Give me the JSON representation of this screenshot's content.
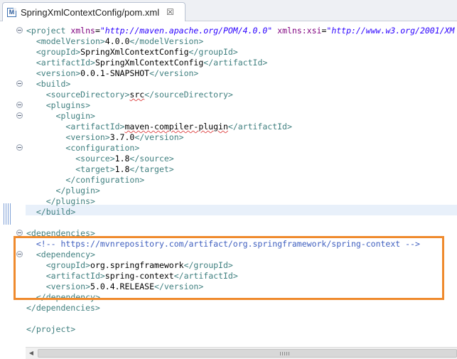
{
  "tab": {
    "icon": "M",
    "title": "SpringXmlContextConfig/pom.xml",
    "close_symbol": "☒"
  },
  "colors": {
    "tag": "#3f7f7f",
    "attribute": "#7f007f",
    "string": "#2a00ff",
    "comment": "#3f5fbf",
    "highlight_box": "#ef8a2d"
  },
  "code": {
    "lines": [
      {
        "indent": "",
        "parts": [
          {
            "k": "t",
            "v": "<project "
          },
          {
            "k": "a",
            "v": "xmlns"
          },
          {
            "k": "x",
            "v": "="
          },
          {
            "k": "s",
            "v": "\"http://maven.apache.org/POM/4.0.0\""
          },
          {
            "k": "x",
            "v": " "
          },
          {
            "k": "a",
            "v": "xmlns:xsi"
          },
          {
            "k": "x",
            "v": "="
          },
          {
            "k": "s",
            "v": "\"http://www.w3.org/2001/XM"
          }
        ]
      },
      {
        "indent": "  ",
        "parts": [
          {
            "k": "t",
            "v": "<modelVersion>"
          },
          {
            "k": "x",
            "v": "4.0.0"
          },
          {
            "k": "t",
            "v": "</modelVersion>"
          }
        ]
      },
      {
        "indent": "  ",
        "parts": [
          {
            "k": "t",
            "v": "<groupId>"
          },
          {
            "k": "x",
            "v": "SpringXmlContextConfig"
          },
          {
            "k": "t",
            "v": "</groupId>"
          }
        ]
      },
      {
        "indent": "  ",
        "parts": [
          {
            "k": "t",
            "v": "<artifactId>"
          },
          {
            "k": "x",
            "v": "SpringXmlContextConfig"
          },
          {
            "k": "t",
            "v": "</artifactId>"
          }
        ]
      },
      {
        "indent": "  ",
        "parts": [
          {
            "k": "t",
            "v": "<version>"
          },
          {
            "k": "x",
            "v": "0.0.1-SNAPSHOT"
          },
          {
            "k": "t",
            "v": "</version>"
          }
        ]
      },
      {
        "indent": "  ",
        "parts": [
          {
            "k": "t",
            "v": "<build>"
          }
        ]
      },
      {
        "indent": "    ",
        "parts": [
          {
            "k": "t",
            "v": "<sourceDirectory>"
          },
          {
            "k": "q",
            "v": "src"
          },
          {
            "k": "t",
            "v": "</sourceDirectory>"
          }
        ]
      },
      {
        "indent": "    ",
        "parts": [
          {
            "k": "t",
            "v": "<plugins>"
          }
        ]
      },
      {
        "indent": "      ",
        "parts": [
          {
            "k": "t",
            "v": "<plugin>"
          }
        ]
      },
      {
        "indent": "        ",
        "parts": [
          {
            "k": "t",
            "v": "<artifactId>"
          },
          {
            "k": "q",
            "v": "maven-compiler-plugin"
          },
          {
            "k": "t",
            "v": "</artifactId>"
          }
        ]
      },
      {
        "indent": "        ",
        "parts": [
          {
            "k": "t",
            "v": "<version>"
          },
          {
            "k": "x",
            "v": "3.7.0"
          },
          {
            "k": "t",
            "v": "</version>"
          }
        ]
      },
      {
        "indent": "        ",
        "parts": [
          {
            "k": "t",
            "v": "<configuration>"
          }
        ]
      },
      {
        "indent": "          ",
        "parts": [
          {
            "k": "t",
            "v": "<source>"
          },
          {
            "k": "x",
            "v": "1.8"
          },
          {
            "k": "t",
            "v": "</source>"
          }
        ]
      },
      {
        "indent": "          ",
        "parts": [
          {
            "k": "t",
            "v": "<target>"
          },
          {
            "k": "x",
            "v": "1.8"
          },
          {
            "k": "t",
            "v": "</target>"
          }
        ]
      },
      {
        "indent": "        ",
        "parts": [
          {
            "k": "t",
            "v": "</configuration>"
          }
        ]
      },
      {
        "indent": "      ",
        "parts": [
          {
            "k": "t",
            "v": "</plugin>"
          }
        ]
      },
      {
        "indent": "    ",
        "parts": [
          {
            "k": "t",
            "v": "</plugins>"
          }
        ]
      },
      {
        "indent": "  ",
        "parts": [
          {
            "k": "t",
            "v": "</build>"
          }
        ]
      },
      {
        "indent": "",
        "parts": []
      },
      {
        "indent": "",
        "parts": [
          {
            "k": "t",
            "v": "<dependencies>"
          }
        ]
      },
      {
        "indent": "  ",
        "parts": [
          {
            "k": "c",
            "v": "<!-- https://mvnrepository.com/artifact/org.springframework/spring-context -->"
          }
        ]
      },
      {
        "indent": "  ",
        "parts": [
          {
            "k": "t",
            "v": "<dependency>"
          }
        ]
      },
      {
        "indent": "    ",
        "parts": [
          {
            "k": "t",
            "v": "<groupId>"
          },
          {
            "k": "x",
            "v": "org.springframework"
          },
          {
            "k": "t",
            "v": "</groupId>"
          }
        ]
      },
      {
        "indent": "    ",
        "parts": [
          {
            "k": "t",
            "v": "<artifactId>"
          },
          {
            "k": "x",
            "v": "spring-context"
          },
          {
            "k": "t",
            "v": "</artifactId>"
          }
        ]
      },
      {
        "indent": "    ",
        "parts": [
          {
            "k": "t",
            "v": "<version>"
          },
          {
            "k": "x",
            "v": "5.0.4.RELEASE"
          },
          {
            "k": "t",
            "v": "</version>"
          }
        ]
      },
      {
        "indent": "  ",
        "parts": [
          {
            "k": "t",
            "v": "</dependency>"
          }
        ]
      },
      {
        "indent": "",
        "parts": [
          {
            "k": "t",
            "v": "</dependencies>"
          }
        ]
      },
      {
        "indent": "",
        "parts": []
      },
      {
        "indent": "",
        "parts": [
          {
            "k": "t",
            "v": "</project>"
          }
        ]
      }
    ]
  }
}
